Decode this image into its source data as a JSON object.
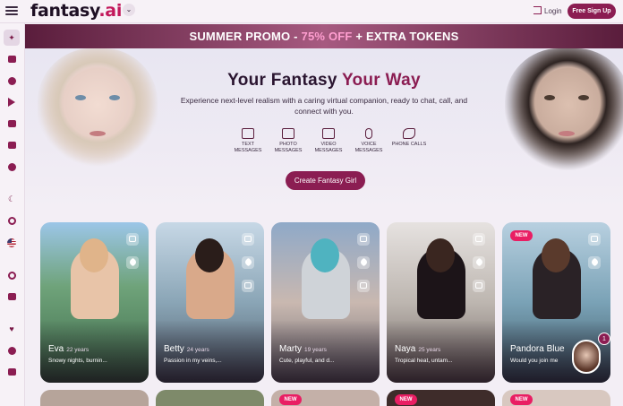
{
  "header": {
    "logo_text": "fantasy",
    "logo_dot": ".ai",
    "chevron": "⌄",
    "login_label": "Login",
    "signup_label": "Free Sign Up"
  },
  "sidebar": {
    "icons": [
      "sparkle-icon",
      "image-icon",
      "compass-icon",
      "play-icon",
      "login-icon",
      "gift-icon",
      "coin-icon",
      "moon-icon",
      "pin-icon",
      "us-flag-icon",
      "globe-icon",
      "camera-icon",
      "heart-icon",
      "user-icon",
      "gallery-icon"
    ]
  },
  "promo": {
    "prefix": "SUMMER PROMO - ",
    "highlight": "75% OFF",
    "suffix": " + EXTRA TOKENS"
  },
  "hero": {
    "title_prefix": "Your Fantasy ",
    "title_accent": "Your Way",
    "subtitle": "Experience next-level realism with a caring virtual companion, ready to chat, call, and connect with you.",
    "features": [
      {
        "label": "TEXT MESSAGES",
        "icon": "chat-icon"
      },
      {
        "label": "PHOTO MESSAGES",
        "icon": "photo-icon"
      },
      {
        "label": "VIDEO MESSAGES",
        "icon": "video-icon"
      },
      {
        "label": "VOICE MESSAGES",
        "icon": "mic-icon"
      },
      {
        "label": "PHONE CALLS",
        "icon": "phone-icon"
      }
    ],
    "cta_label": "Create Fantasy Girl"
  },
  "cards": [
    {
      "name": "Eva",
      "age": "22 years",
      "tag": "Snowy nights, burnin...",
      "is_new": false
    },
    {
      "name": "Betty",
      "age": "24 years",
      "tag": "Passion in my veins,...",
      "is_new": false
    },
    {
      "name": "Marty",
      "age": "19 years",
      "tag": "Cute, playful, and d...",
      "is_new": false
    },
    {
      "name": "Naya",
      "age": "25 years",
      "tag": "Tropical heat, untam...",
      "is_new": false
    },
    {
      "name": "Pandora Blue",
      "age": "",
      "tag": "Would you join me",
      "is_new": true
    }
  ],
  "new_badge_label": "NEW",
  "chat_avatar": {
    "unread_count": "1"
  },
  "colors": {
    "brand": "#8b1d52",
    "accent_pink": "#e91e63",
    "promo_highlight": "#ff9ed0"
  }
}
